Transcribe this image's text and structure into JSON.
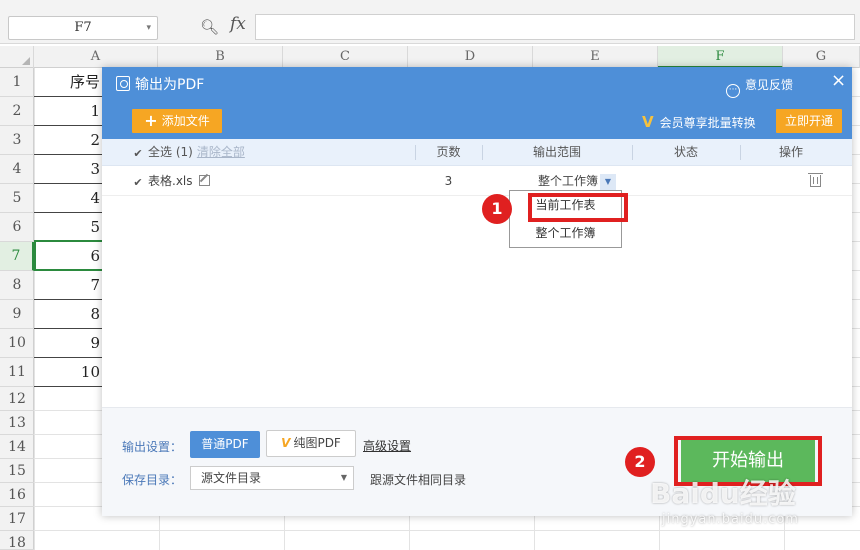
{
  "formula_bar": {
    "cell_ref": "F7",
    "fx_label": "fx",
    "zoom_icon": "zoom-icon",
    "content": ""
  },
  "sheet": {
    "columns": [
      "A",
      "B",
      "C",
      "D",
      "E",
      "F",
      "G"
    ],
    "active_column": "F",
    "rows": [
      "1",
      "2",
      "3",
      "4",
      "5",
      "6",
      "7",
      "8",
      "9",
      "10",
      "11",
      "12",
      "13",
      "14",
      "15",
      "16",
      "17",
      "18"
    ],
    "active_row": "7",
    "col_a_values": [
      "序号",
      "1",
      "2",
      "3",
      "4",
      "5",
      "6",
      "7",
      "8",
      "9",
      "10"
    ]
  },
  "dialog": {
    "title": "输出为PDF",
    "feedback": "意见反馈",
    "close": "×",
    "add_file": "添加文件",
    "vip_text": "会员尊享批量转换",
    "open_now": "立即开通",
    "table": {
      "select_all": "全选 (1)",
      "clear_all": "清除全部",
      "headers": {
        "pages": "页数",
        "range": "输出范围",
        "status": "状态",
        "action": "操作"
      },
      "rows": [
        {
          "name": "表格.xls",
          "pages": "3",
          "range": "整个工作簿",
          "status": ""
        }
      ]
    },
    "dropdown": {
      "options": [
        "当前工作表",
        "整个工作簿"
      ]
    },
    "bottom": {
      "output_settings_label": "输出设置：",
      "normal_pdf": "普通PDF",
      "image_pdf": "纯图PDF",
      "advanced": "高级设置",
      "save_dir_label": "保存目录：",
      "save_dir_value": "源文件目录",
      "same_dir": "跟源文件相同目录",
      "start_output": "开始输出"
    }
  },
  "annotations": {
    "badge1": "1",
    "badge2": "2",
    "color": "#e02020"
  },
  "watermark": {
    "text": "Baidu经验",
    "sub": "jingyan.baidu.com"
  }
}
